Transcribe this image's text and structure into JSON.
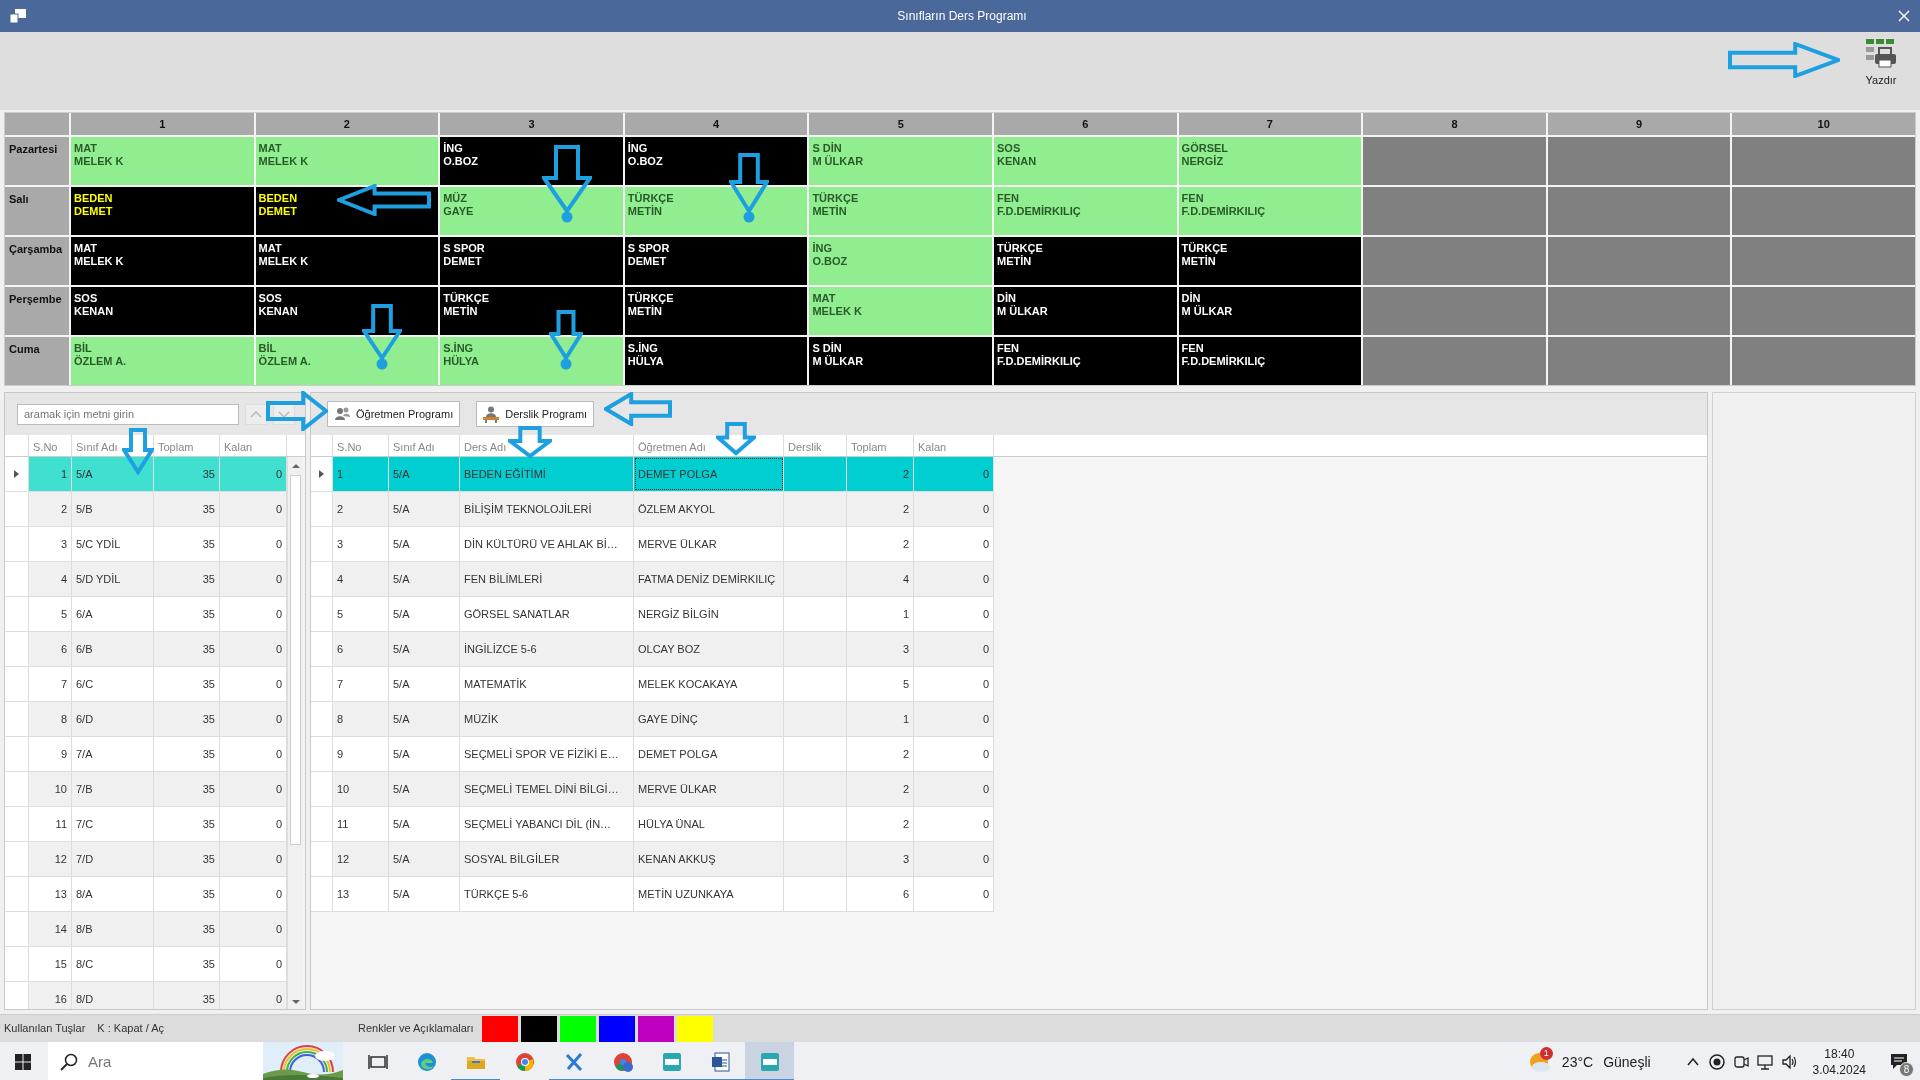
{
  "window": {
    "title": "Sınıfların Ders Programı"
  },
  "toolbar": {
    "print_label": "Yazdır"
  },
  "timetable": {
    "periods": [
      "1",
      "2",
      "3",
      "4",
      "5",
      "6",
      "7",
      "8",
      "9",
      "10"
    ],
    "days": [
      {
        "name": "Pazartesi",
        "cells": [
          {
            "lines": [
              "MAT",
              "MELEK K"
            ],
            "color": "#90ee90",
            "highlighted": false
          },
          {
            "lines": [
              "MAT",
              "MELEK K"
            ],
            "color": "#90ee90",
            "highlighted": false
          },
          {
            "lines": [
              "İNG",
              "O.BOZ"
            ],
            "color": "#000000",
            "highlighted": false
          },
          {
            "lines": [
              "İNG",
              "O.BOZ"
            ],
            "color": "#000000",
            "highlighted": false
          },
          {
            "lines": [
              "S DİN",
              "M ÜLKAR"
            ],
            "color": "#90ee90",
            "highlighted": false
          },
          {
            "lines": [
              "SOS",
              "KENAN"
            ],
            "color": "#90ee90",
            "highlighted": false
          },
          {
            "lines": [
              "GÖRSEL",
              "NERGİZ"
            ],
            "color": "#90ee90",
            "highlighted": false
          },
          {
            "color": "#808080"
          },
          {
            "color": "#808080"
          },
          {
            "color": "#808080"
          }
        ]
      },
      {
        "name": "Salı",
        "cells": [
          {
            "lines": [
              "BEDEN",
              "DEMET"
            ],
            "color": "#000000",
            "highlighted": true
          },
          {
            "lines": [
              "BEDEN",
              "DEMET"
            ],
            "color": "#000000",
            "highlighted": true
          },
          {
            "lines": [
              "MÜZ",
              "GAYE"
            ],
            "color": "#90ee90",
            "highlighted": false
          },
          {
            "lines": [
              "TÜRKÇE",
              "METİN"
            ],
            "color": "#90ee90",
            "highlighted": false
          },
          {
            "lines": [
              "TÜRKÇE",
              "METİN"
            ],
            "color": "#90ee90",
            "highlighted": false
          },
          {
            "lines": [
              "FEN",
              "F.D.DEMİRKILIÇ"
            ],
            "color": "#90ee90",
            "highlighted": false
          },
          {
            "lines": [
              "FEN",
              "F.D.DEMİRKILIÇ"
            ],
            "color": "#90ee90",
            "highlighted": false
          },
          {
            "color": "#808080"
          },
          {
            "color": "#808080"
          },
          {
            "color": "#808080"
          }
        ]
      },
      {
        "name": "Çarşamba",
        "cells": [
          {
            "lines": [
              "MAT",
              "MELEK K"
            ],
            "color": "#000000",
            "highlighted": false
          },
          {
            "lines": [
              "MAT",
              "MELEK K"
            ],
            "color": "#000000",
            "highlighted": false
          },
          {
            "lines": [
              "S SPOR",
              "DEMET"
            ],
            "color": "#000000",
            "highlighted": false
          },
          {
            "lines": [
              "S SPOR",
              "DEMET"
            ],
            "color": "#000000",
            "highlighted": false
          },
          {
            "lines": [
              "İNG",
              "O.BOZ"
            ],
            "color": "#90ee90",
            "highlighted": false
          },
          {
            "lines": [
              "TÜRKÇE",
              "METİN"
            ],
            "color": "#000000",
            "highlighted": false
          },
          {
            "lines": [
              "TÜRKÇE",
              "METİN"
            ],
            "color": "#000000",
            "highlighted": false
          },
          {
            "color": "#808080"
          },
          {
            "color": "#808080"
          },
          {
            "color": "#808080"
          }
        ]
      },
      {
        "name": "Perşembe",
        "cells": [
          {
            "lines": [
              "SOS",
              "KENAN"
            ],
            "color": "#000000",
            "highlighted": false
          },
          {
            "lines": [
              "SOS",
              "KENAN"
            ],
            "color": "#000000",
            "highlighted": false
          },
          {
            "lines": [
              "TÜRKÇE",
              "METİN"
            ],
            "color": "#000000",
            "highlighted": false
          },
          {
            "lines": [
              "TÜRKÇE",
              "METİN"
            ],
            "color": "#000000",
            "highlighted": false
          },
          {
            "lines": [
              "MAT",
              "MELEK K"
            ],
            "color": "#90ee90",
            "highlighted": false
          },
          {
            "lines": [
              "DİN",
              "M ÜLKAR"
            ],
            "color": "#000000",
            "highlighted": false
          },
          {
            "lines": [
              "DİN",
              "M ÜLKAR"
            ],
            "color": "#000000",
            "highlighted": false
          },
          {
            "color": "#808080"
          },
          {
            "color": "#808080"
          },
          {
            "color": "#808080"
          }
        ]
      },
      {
        "name": "Cuma",
        "cells": [
          {
            "lines": [
              "BİL",
              "ÖZLEM A."
            ],
            "color": "#90ee90",
            "highlighted": false
          },
          {
            "lines": [
              "BİL",
              "ÖZLEM A."
            ],
            "color": "#90ee90",
            "highlighted": false
          },
          {
            "lines": [
              "S.İNG",
              "HÜLYA"
            ],
            "color": "#90ee90",
            "highlighted": false
          },
          {
            "lines": [
              "S.İNG",
              "HÜLYA"
            ],
            "color": "#000000",
            "highlighted": false
          },
          {
            "lines": [
              "S DİN",
              "M ÜLKAR"
            ],
            "color": "#000000",
            "highlighted": false
          },
          {
            "lines": [
              "FEN",
              "F.D.DEMİRKILIÇ"
            ],
            "color": "#000000",
            "highlighted": false
          },
          {
            "lines": [
              "FEN",
              "F.D.DEMİRKILIÇ"
            ],
            "color": "#000000",
            "highlighted": false
          },
          {
            "color": "#808080"
          },
          {
            "color": "#808080"
          },
          {
            "color": "#808080"
          }
        ]
      }
    ]
  },
  "class_list": {
    "search_placeholder": "aramak için metni girin",
    "columns": [
      "S.No",
      "Sınıf Adı",
      "Toplam",
      "Kalan"
    ],
    "rows": [
      {
        "no": "1",
        "class": "5/A",
        "total": "35",
        "remaining": "0",
        "selected": true
      },
      {
        "no": "2",
        "class": "5/B",
        "total": "35",
        "remaining": "0",
        "selected": false
      },
      {
        "no": "3",
        "class": "5/C YDİL",
        "total": "35",
        "remaining": "0",
        "selected": false
      },
      {
        "no": "4",
        "class": "5/D YDİL",
        "total": "35",
        "remaining": "0",
        "selected": false
      },
      {
        "no": "5",
        "class": "6/A",
        "total": "35",
        "remaining": "0",
        "selected": false
      },
      {
        "no": "6",
        "class": "6/B",
        "total": "35",
        "remaining": "0",
        "selected": false
      },
      {
        "no": "7",
        "class": "6/C",
        "total": "35",
        "remaining": "0",
        "selected": false
      },
      {
        "no": "8",
        "class": "6/D",
        "total": "35",
        "remaining": "0",
        "selected": false
      },
      {
        "no": "9",
        "class": "7/A",
        "total": "35",
        "remaining": "0",
        "selected": false
      },
      {
        "no": "10",
        "class": "7/B",
        "total": "35",
        "remaining": "0",
        "selected": false
      },
      {
        "no": "11",
        "class": "7/C",
        "total": "35",
        "remaining": "0",
        "selected": false
      },
      {
        "no": "12",
        "class": "7/D",
        "total": "35",
        "remaining": "0",
        "selected": false
      },
      {
        "no": "13",
        "class": "8/A",
        "total": "35",
        "remaining": "0",
        "selected": false
      },
      {
        "no": "14",
        "class": "8/B",
        "total": "35",
        "remaining": "0",
        "selected": false
      },
      {
        "no": "15",
        "class": "8/C",
        "total": "35",
        "remaining": "0",
        "selected": false
      },
      {
        "no": "16",
        "class": "8/D",
        "total": "35",
        "remaining": "0",
        "selected": false
      }
    ]
  },
  "lesson_panel": {
    "buttons": [
      "Öğretmen Programı",
      "Derslik Programı"
    ],
    "columns": [
      "S.No",
      "Sınıf Adı",
      "Ders Adı",
      "Öğretmen Adı",
      "Derslik",
      "Toplam",
      "Kalan"
    ],
    "rows": [
      {
        "no": "1",
        "class": "5/A",
        "lesson": "BEDEN EĞİTİMİ",
        "teacher": "DEMET POLGA",
        "total": "2",
        "remaining": "0",
        "selected": true
      },
      {
        "no": "2",
        "class": "5/A",
        "lesson": "BİLİŞİM TEKNOLOJİLERİ",
        "teacher": "ÖZLEM AKYOL",
        "total": "2",
        "remaining": "0",
        "selected": false
      },
      {
        "no": "3",
        "class": "5/A",
        "lesson": "DİN KÜLTÜRÜ VE AHLAK Bİ…",
        "teacher": "MERVE ÜLKAR",
        "total": "2",
        "remaining": "0",
        "selected": false
      },
      {
        "no": "4",
        "class": "5/A",
        "lesson": "FEN BİLİMLERİ",
        "teacher": "FATMA DENİZ DEMİRKILIÇ",
        "total": "4",
        "remaining": "0",
        "selected": false
      },
      {
        "no": "5",
        "class": "5/A",
        "lesson": "GÖRSEL SANATLAR",
        "teacher": "NERGİZ BİLGİN",
        "total": "1",
        "remaining": "0",
        "selected": false
      },
      {
        "no": "6",
        "class": "5/A",
        "lesson": "İNGİLİZCE 5-6",
        "teacher": "OLCAY BOZ",
        "total": "3",
        "remaining": "0",
        "selected": false
      },
      {
        "no": "7",
        "class": "5/A",
        "lesson": "MATEMATİK",
        "teacher": "MELEK KOCAKAYA",
        "total": "5",
        "remaining": "0",
        "selected": false
      },
      {
        "no": "8",
        "class": "5/A",
        "lesson": "MÜZİK",
        "teacher": "GAYE DİNÇ",
        "total": "1",
        "remaining": "0",
        "selected": false
      },
      {
        "no": "9",
        "class": "5/A",
        "lesson": "SEÇMELİ SPOR VE FİZİKİ E…",
        "teacher": "DEMET POLGA",
        "total": "2",
        "remaining": "0",
        "selected": false
      },
      {
        "no": "10",
        "class": "5/A",
        "lesson": "SEÇMELİ TEMEL DİNİ BİLGİ…",
        "teacher": "MERVE ÜLKAR",
        "total": "2",
        "remaining": "0",
        "selected": false
      },
      {
        "no": "11",
        "class": "5/A",
        "lesson": "SEÇMELİ YABANCI DİL (İN…",
        "teacher": "HÜLYA ÜNAL",
        "total": "2",
        "remaining": "0",
        "selected": false
      },
      {
        "no": "12",
        "class": "5/A",
        "lesson": "SOSYAL BİLGİLER",
        "teacher": "KENAN AKKUŞ",
        "total": "3",
        "remaining": "0",
        "selected": false
      },
      {
        "no": "13",
        "class": "5/A",
        "lesson": "TÜRKÇE 5-6",
        "teacher": "METİN UZUNKAYA",
        "total": "6",
        "remaining": "0",
        "selected": false
      }
    ]
  },
  "status_bar": {
    "keys_label": "Kullanılan Tuşlar",
    "keys_hint": "K : Kapat / Aç",
    "colors_label": "Renkler ve Açıklamaları",
    "swatches": [
      {
        "color": "#ff0000"
      },
      {
        "color": "#000000"
      },
      {
        "color": "#00ff00"
      },
      {
        "color": "#0000ff"
      },
      {
        "color": "#c000c0"
      },
      {
        "color": "#ffff00"
      }
    ]
  },
  "taskbar": {
    "search_placeholder": "Ara",
    "apps": [
      {
        "kind": "task-view",
        "running": false,
        "selected": false
      },
      {
        "kind": "edge",
        "running": false,
        "selected": false
      },
      {
        "kind": "explorer",
        "running": true,
        "selected": false
      },
      {
        "kind": "chrome",
        "running": false,
        "selected": false
      },
      {
        "kind": "x-app",
        "running": true,
        "selected": false
      },
      {
        "kind": "chrome-profile",
        "running": true,
        "selected": false
      },
      {
        "kind": "matena",
        "running": true,
        "selected": false
      },
      {
        "kind": "word",
        "running": true,
        "selected": false
      },
      {
        "kind": "matena",
        "running": true,
        "selected": true
      }
    ],
    "weather": {
      "badge": "1",
      "temperature": "23°C",
      "condition": "Güneşli"
    },
    "clock": {
      "time": "18:40",
      "date": "3.04.2024"
    },
    "notifications": {
      "count": "8"
    }
  }
}
